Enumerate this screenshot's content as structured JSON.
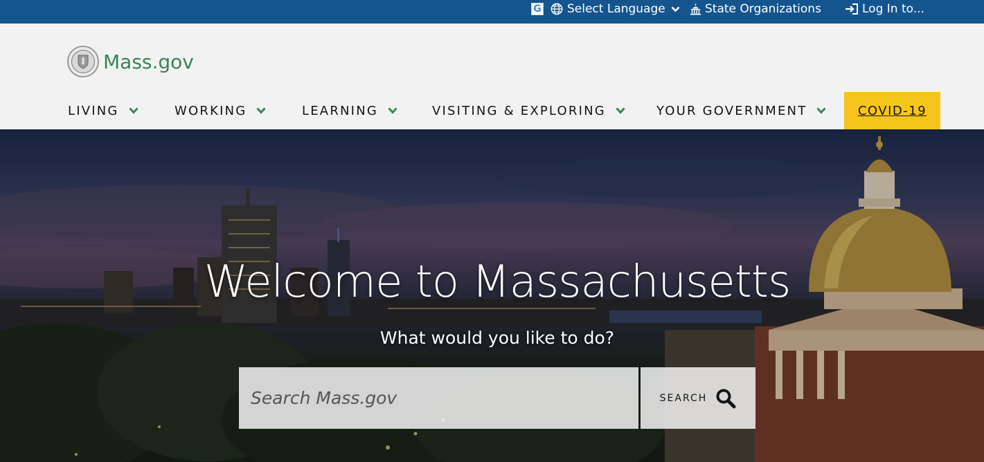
{
  "utility": {
    "language_label": "Select Language",
    "state_orgs_label": "State Organizations",
    "login_label": "Log In to..."
  },
  "logo": {
    "text": "Mass.gov"
  },
  "nav": {
    "items": [
      {
        "label": "LIVING"
      },
      {
        "label": "WORKING"
      },
      {
        "label": "LEARNING"
      },
      {
        "label": "VISITING & EXPLORING"
      },
      {
        "label": "YOUR GOVERNMENT"
      }
    ],
    "covid_label": "COVID-19"
  },
  "hero": {
    "title": "Welcome to Massachusetts",
    "subtitle": "What would you like to do?",
    "search_placeholder": "Search Mass.gov",
    "search_button": "SEARCH"
  },
  "colors": {
    "utility_bg": "#14558f",
    "header_bg": "#f2f2f2",
    "brand_green": "#388557",
    "covid_bg": "#f6c51b"
  }
}
